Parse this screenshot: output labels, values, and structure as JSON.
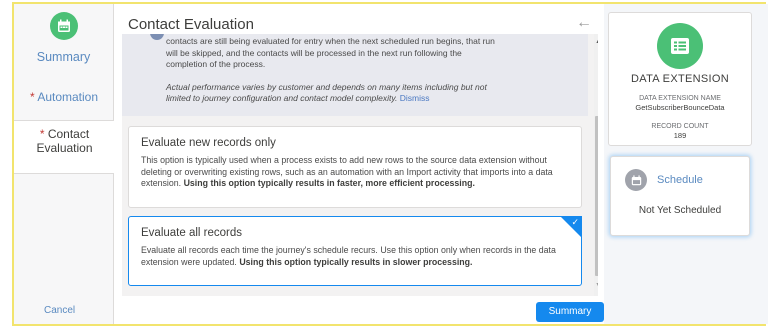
{
  "nav": {
    "summary_label": "Summary",
    "automation_label": "Automation",
    "contact_label_line1": "Contact",
    "contact_label_line2": "Evaluation",
    "required_marker": "*",
    "cancel_label": "Cancel"
  },
  "main": {
    "title": "Contact Evaluation",
    "back_icon": "back-arrow-icon",
    "info": {
      "text_line1": "contacts are still being evaluated for entry when the next scheduled run begins, that run",
      "text_line2": "will be skipped, and the contacts will be processed in the next run following the",
      "text_line3": "completion of the process.",
      "italic_line1": "Actual performance varies by customer and depends on many items including but not",
      "italic_line2": "limited to journey configuration and contact model complexity.",
      "dismiss_label": "Dismiss"
    },
    "options": [
      {
        "title": "Evaluate new records only",
        "description": "This option is typically used when a process exists to add new rows to the source data extension without deleting or overwriting existing rows, such as an automation with an Import activity that imports into a data extension.",
        "emphasis": "Using this option typically results in faster, more efficient processing.",
        "selected": false
      },
      {
        "title": "Evaluate all records",
        "description": "Evaluate all records each time the journey's schedule recurs. Use this option only when records in the data extension were updated.",
        "emphasis": "Using this option typically results in slower processing.",
        "selected": true
      }
    ],
    "summary_button": "Summary"
  },
  "right": {
    "data_extension": {
      "title": "DATA EXTENSION",
      "name_label": "DATA EXTENSION NAME",
      "name": "GetSubscriberBounceData",
      "count_label": "RECORD COUNT",
      "count": "189"
    },
    "schedule": {
      "title": "Schedule",
      "status": "Not Yet Scheduled"
    }
  },
  "colors": {
    "accent": "#1589ee",
    "green_icon": "#4bc076",
    "link": "#5a8ac0",
    "required": "#c23934",
    "highlight_border": "#f2e46e"
  }
}
